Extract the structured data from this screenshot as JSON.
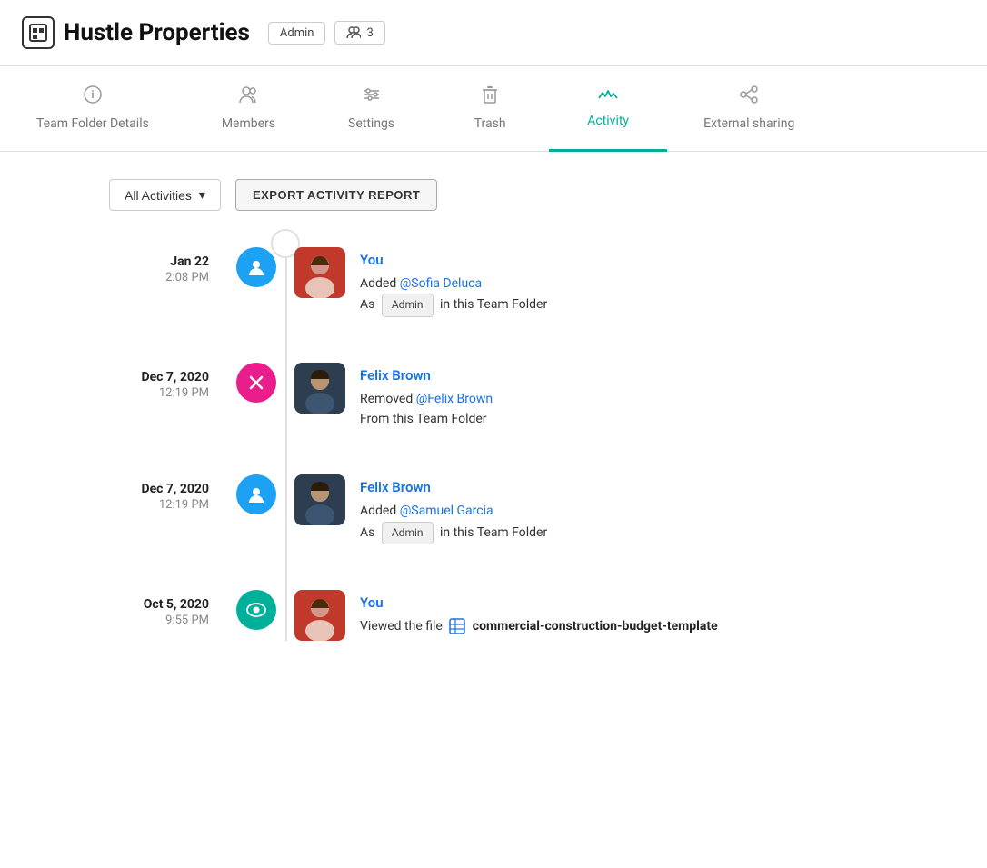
{
  "header": {
    "logo_text": "Hustle Properties",
    "logo_icon": "🏢",
    "admin_label": "Admin",
    "members_count": "3"
  },
  "tabs": [
    {
      "id": "team-folder-details",
      "label": "Team Folder Details",
      "icon": "ℹ️",
      "active": false
    },
    {
      "id": "members",
      "label": "Members",
      "icon": "👤",
      "active": false
    },
    {
      "id": "settings",
      "label": "Settings",
      "icon": "⚙️",
      "active": false
    },
    {
      "id": "trash",
      "label": "Trash",
      "icon": "🗑️",
      "active": false
    },
    {
      "id": "activity",
      "label": "Activity",
      "icon": "📈",
      "active": true
    },
    {
      "id": "external-sharing",
      "label": "External sharing",
      "icon": "🔗",
      "active": false
    }
  ],
  "toolbar": {
    "filter_label": "All Activities",
    "export_label": "EXPORT ACTIVITY REPORT"
  },
  "activities": [
    {
      "date": "Jan 22",
      "time": "2:08 PM",
      "node_type": "blue",
      "avatar_type": "woman",
      "actor": "You",
      "action_line1": "Added @Sofia Deluca",
      "mention": "@Sofia Deluca",
      "action_line2": "As",
      "role": "Admin",
      "action_line3": "in this Team Folder"
    },
    {
      "date": "Dec 7, 2020",
      "time": "12:19 PM",
      "node_type": "pink",
      "avatar_type": "man",
      "actor": "Felix Brown",
      "action_line1": "Removed @Felix Brown",
      "mention": "@Felix Brown",
      "action_line2": "From this Team Folder"
    },
    {
      "date": "Dec 7, 2020",
      "time": "12:19 PM",
      "node_type": "blue",
      "avatar_type": "man",
      "actor": "Felix Brown",
      "action_line1": "Added @Samuel Garcia",
      "mention": "@Samuel Garcia",
      "action_line2": "As",
      "role": "Admin",
      "action_line3": "in this Team Folder"
    },
    {
      "date": "Oct 5, 2020",
      "time": "9:55 PM",
      "node_type": "teal",
      "avatar_type": "woman",
      "actor": "You",
      "action_line1": "Viewed the file",
      "file_name": "commercial-construction-budget-template"
    }
  ]
}
